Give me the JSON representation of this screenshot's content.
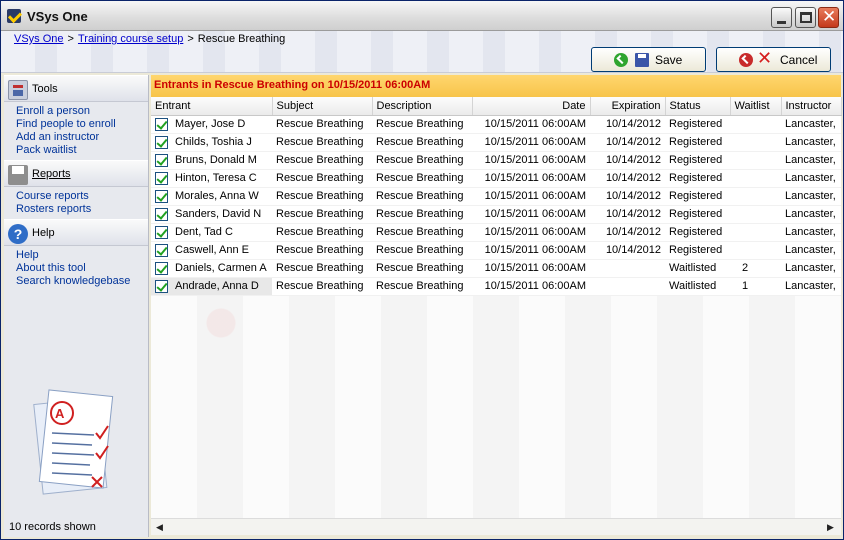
{
  "window": {
    "title": "VSys One"
  },
  "breadcrumb": {
    "items": [
      "VSys One",
      "Training course setup"
    ],
    "current": "Rescue Breathing",
    "separator": ">"
  },
  "toolbar": {
    "save_label": "Save",
    "cancel_label": "Cancel"
  },
  "sidebar": {
    "sections": [
      {
        "title": "Tools",
        "links": [
          "Enroll a person",
          "Find people to enroll",
          "Add an instructor",
          "Pack waitlist"
        ]
      },
      {
        "title": "Reports",
        "links": [
          "Course reports",
          "Rosters reports"
        ]
      },
      {
        "title": "Help",
        "links": [
          "Help",
          "About this tool",
          "Search knowledgebase"
        ]
      }
    ],
    "records_shown": "10 records shown"
  },
  "main": {
    "heading": "Entrants in Rescue Breathing on 10/15/2011 06:00AM",
    "columns": [
      "Entrant",
      "Subject",
      "Description",
      "Date",
      "Expiration",
      "Status",
      "Waitlist",
      "Instructor"
    ],
    "rows": [
      {
        "entrant": "Mayer, Jose D",
        "subject": "Rescue Breathing",
        "description": "Rescue Breathing",
        "date": "10/15/2011 06:00AM",
        "expiration": "10/14/2012",
        "status": "Registered",
        "waitlist": "",
        "instructor": "Lancaster,"
      },
      {
        "entrant": "Childs, Toshia J",
        "subject": "Rescue Breathing",
        "description": "Rescue Breathing",
        "date": "10/15/2011 06:00AM",
        "expiration": "10/14/2012",
        "status": "Registered",
        "waitlist": "",
        "instructor": "Lancaster,"
      },
      {
        "entrant": "Bruns, Donald M",
        "subject": "Rescue Breathing",
        "description": "Rescue Breathing",
        "date": "10/15/2011 06:00AM",
        "expiration": "10/14/2012",
        "status": "Registered",
        "waitlist": "",
        "instructor": "Lancaster,"
      },
      {
        "entrant": "Hinton, Teresa C",
        "subject": "Rescue Breathing",
        "description": "Rescue Breathing",
        "date": "10/15/2011 06:00AM",
        "expiration": "10/14/2012",
        "status": "Registered",
        "waitlist": "",
        "instructor": "Lancaster,"
      },
      {
        "entrant": "Morales, Anna W",
        "subject": "Rescue Breathing",
        "description": "Rescue Breathing",
        "date": "10/15/2011 06:00AM",
        "expiration": "10/14/2012",
        "status": "Registered",
        "waitlist": "",
        "instructor": "Lancaster,"
      },
      {
        "entrant": "Sanders, David N",
        "subject": "Rescue Breathing",
        "description": "Rescue Breathing",
        "date": "10/15/2011 06:00AM",
        "expiration": "10/14/2012",
        "status": "Registered",
        "waitlist": "",
        "instructor": "Lancaster,"
      },
      {
        "entrant": "Dent, Tad C",
        "subject": "Rescue Breathing",
        "description": "Rescue Breathing",
        "date": "10/15/2011 06:00AM",
        "expiration": "10/14/2012",
        "status": "Registered",
        "waitlist": "",
        "instructor": "Lancaster,"
      },
      {
        "entrant": "Caswell, Ann E",
        "subject": "Rescue Breathing",
        "description": "Rescue Breathing",
        "date": "10/15/2011 06:00AM",
        "expiration": "10/14/2012",
        "status": "Registered",
        "waitlist": "",
        "instructor": "Lancaster,"
      },
      {
        "entrant": "Daniels, Carmen A",
        "subject": "Rescue Breathing",
        "description": "Rescue Breathing",
        "date": "10/15/2011 06:00AM",
        "expiration": "",
        "status": "Waitlisted",
        "waitlist": "2",
        "instructor": "Lancaster,"
      },
      {
        "entrant": "Andrade, Anna D",
        "subject": "Rescue Breathing",
        "description": "Rescue Breathing",
        "date": "10/15/2011 06:00AM",
        "expiration": "",
        "status": "Waitlisted",
        "waitlist": "1",
        "instructor": "Lancaster,"
      }
    ]
  },
  "colors": {
    "heading_text": "#cc0000",
    "heading_bg": "#f7c44a",
    "link": "#0000cc",
    "check": "#21a121"
  }
}
